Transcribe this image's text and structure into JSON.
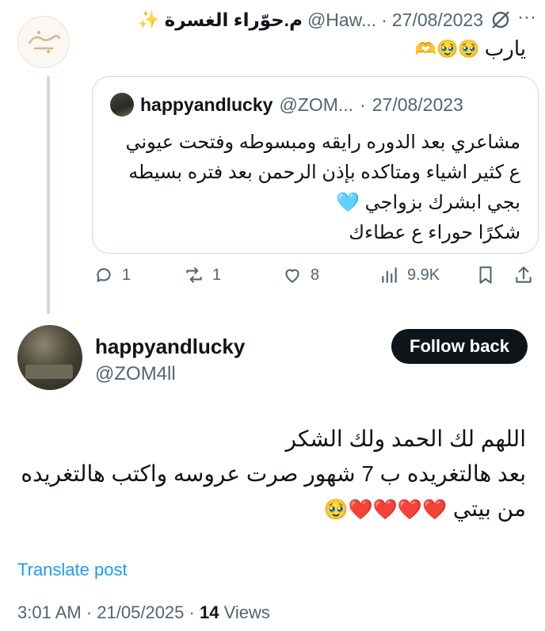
{
  "parent_tweet": {
    "display_name": "م.حوّراء الغسرة",
    "handle": "@Haw...",
    "separator": "·",
    "date": "27/08/2023",
    "text": "يارب",
    "emojis": "🥹🥹🫶",
    "quoted": {
      "display_name": "happyandlucky",
      "handle": "@ZOM...",
      "separator": "·",
      "date": "27/08/2023",
      "lines": [
        "مشاعري بعد الدوره رايقه ومبسوطه وفتحت عيوني",
        "ع كثير اشياء ومتاكده بإذن الرحمن بعد فتره بسيطه",
        "بجي ابشرك بزواجي 🩵",
        "شكرًا حوراء ع عطاءك"
      ]
    },
    "actions": {
      "replies": "1",
      "reposts": "1",
      "likes": "8",
      "views": "9.9K"
    }
  },
  "main_tweet": {
    "display_name": "happyandlucky",
    "handle": "@ZOM4ll",
    "follow_label": "Follow back",
    "lines": [
      "اللهم لك الحمد ولك الشكر",
      "بعد هالتغريده ب 7 شهور صرت عروسه واكتب هالتغريده",
      "من بيتي"
    ],
    "hearts": "❤️❤️❤️❤️🥹",
    "translate_label": "Translate post",
    "time": "3:01 AM",
    "separator": "·",
    "date": "21/05/2025",
    "separator2": "·",
    "views_count": "14",
    "views_label": "Views"
  },
  "icons": [
    "grok-icon",
    "more-icon",
    "reply-icon",
    "repost-icon",
    "like-icon",
    "views-icon",
    "bookmark-icon",
    "share-icon"
  ]
}
